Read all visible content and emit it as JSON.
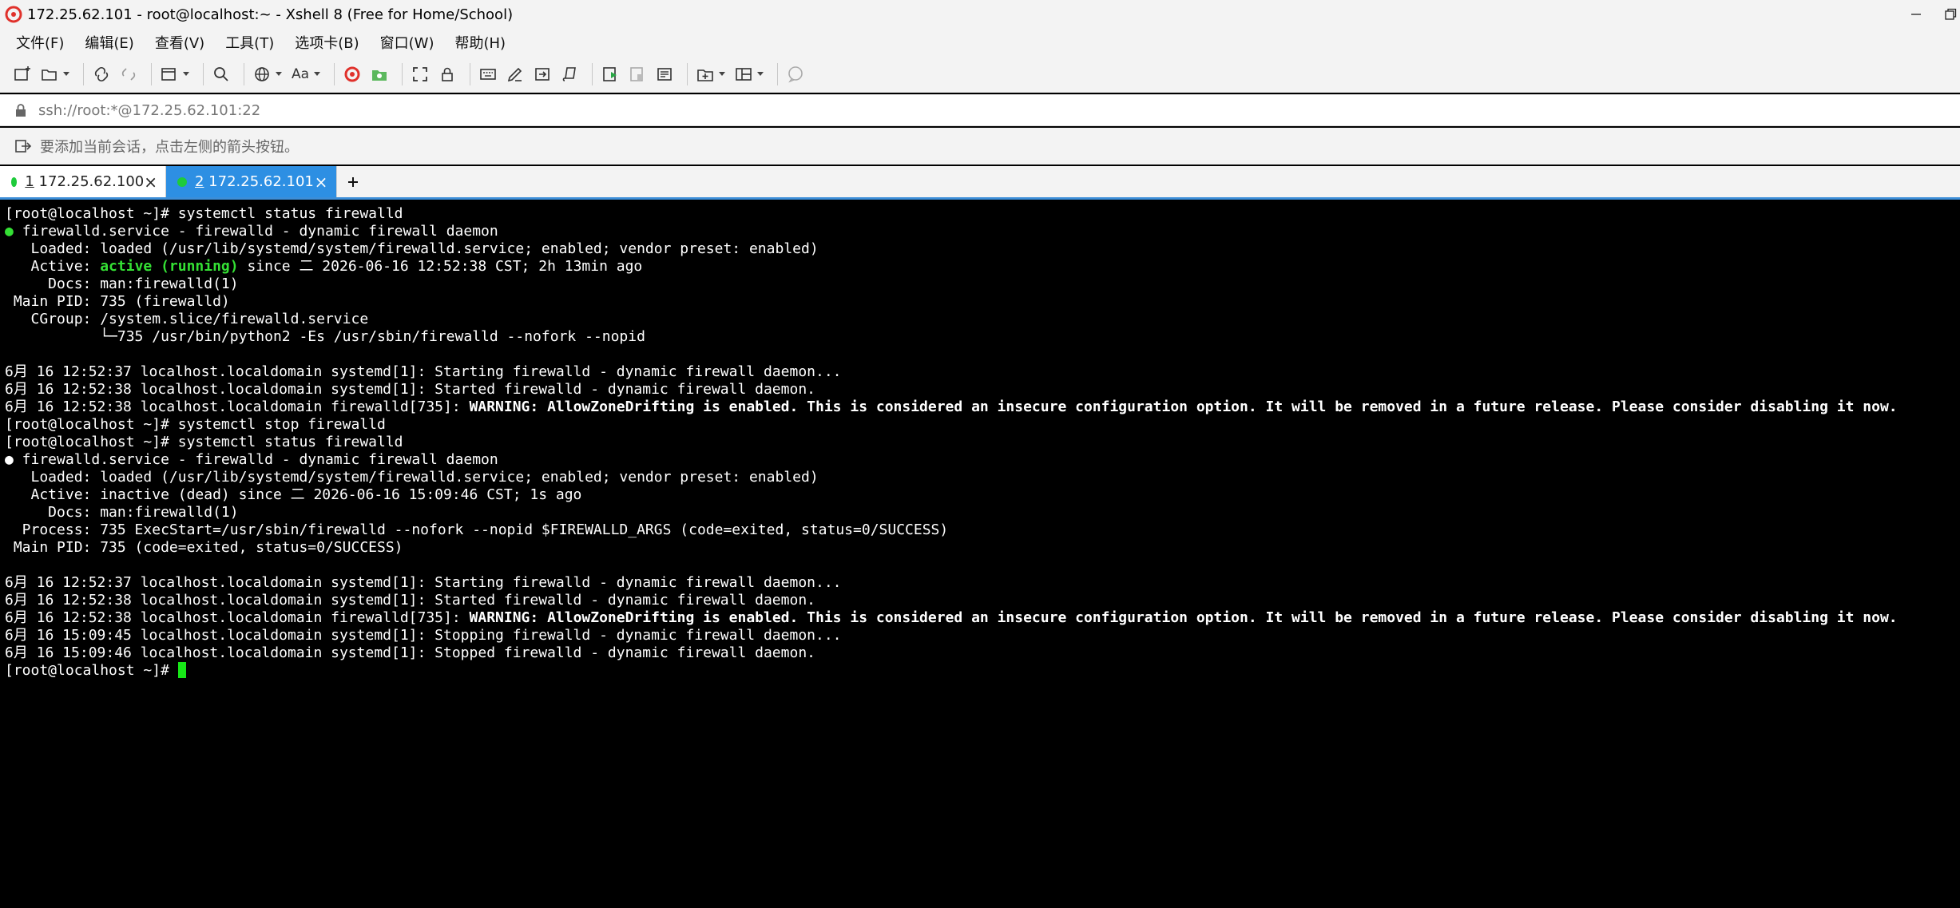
{
  "window": {
    "title": "172.25.62.101 - root@localhost:~ - Xshell 8 (Free for Home/School)",
    "app_icon": "xshell-logo"
  },
  "menu": [
    "文件(F)",
    "编辑(E)",
    "查看(V)",
    "工具(T)",
    "选项卡(B)",
    "窗口(W)",
    "帮助(H)"
  ],
  "toolbar": {
    "font_label": "Aa",
    "icons": [
      "new-session-icon",
      "open-folder-icon",
      "connect-icon",
      "disconnect-icon",
      "new-window-icon",
      "search-icon",
      "globe-icon",
      "font-icon",
      "xshell-red-icon",
      "xftp-green-icon",
      "fullscreen-icon",
      "lock-icon",
      "keyboard-icon",
      "compose-icon",
      "send-icon",
      "script-icon",
      "log-start-icon",
      "log-stop-icon",
      "notes-icon",
      "add-tab-icon",
      "layout-icon",
      "chat-icon"
    ]
  },
  "address": {
    "value": "ssh://root:*@172.25.62.101:22"
  },
  "hint": {
    "text": "要添加当前会话，点击左侧的箭头按钮。"
  },
  "tabs": [
    {
      "number": "1",
      "label": " 172.25.62.100",
      "status_color": "#1ecb3b",
      "active": false
    },
    {
      "number": "2",
      "label": " 172.25.62.101",
      "status_color": "#1ecb3b",
      "active": true
    }
  ],
  "terminal": {
    "prompt": "[root@localhost ~]# ",
    "lines": [
      {
        "segments": [
          {
            "text": "[root@localhost ~]# systemctl status firewalld"
          }
        ]
      },
      {
        "segments": [
          {
            "text": "● ",
            "style": "green"
          },
          {
            "text": "firewalld.service - firewalld - dynamic firewall daemon"
          }
        ]
      },
      {
        "segments": [
          {
            "text": "   Loaded: loaded (/usr/lib/systemd/system/firewalld.service; enabled; vendor preset: enabled)"
          }
        ]
      },
      {
        "segments": [
          {
            "text": "   Active: "
          },
          {
            "text": "active (running)",
            "style": "green"
          },
          {
            "text": " since 二 2026-06-16 12:52:38 CST; 2h 13min ago"
          }
        ]
      },
      {
        "segments": [
          {
            "text": "     Docs: man:firewalld(1)"
          }
        ]
      },
      {
        "segments": [
          {
            "text": " Main PID: 735 (firewalld)"
          }
        ]
      },
      {
        "segments": [
          {
            "text": "   CGroup: /system.slice/firewalld.service"
          }
        ]
      },
      {
        "segments": [
          {
            "text": "           └─735 /usr/bin/python2 -Es /usr/sbin/firewalld --nofork --nopid"
          }
        ]
      },
      {
        "segments": [
          {
            "text": ""
          }
        ]
      },
      {
        "segments": [
          {
            "text": "6月 16 12:52:37 localhost.localdomain systemd[1]: Starting firewalld - dynamic firewall daemon..."
          }
        ]
      },
      {
        "segments": [
          {
            "text": "6月 16 12:52:38 localhost.localdomain systemd[1]: Started firewalld - dynamic firewall daemon."
          }
        ]
      },
      {
        "segments": [
          {
            "text": "6月 16 12:52:38 localhost.localdomain firewalld[735]: "
          },
          {
            "text": "WARNING: AllowZoneDrifting is enabled. This is considered an insecure configuration option. It will be removed in a future release. Please consider disabling it now.",
            "style": "white-bold"
          }
        ]
      },
      {
        "segments": [
          {
            "text": "[root@localhost ~]# systemctl stop firewalld"
          }
        ]
      },
      {
        "segments": [
          {
            "text": "[root@localhost ~]# systemctl status firewalld"
          }
        ]
      },
      {
        "segments": [
          {
            "text": "● firewalld.service - firewalld - dynamic firewall daemon"
          }
        ]
      },
      {
        "segments": [
          {
            "text": "   Loaded: loaded (/usr/lib/systemd/system/firewalld.service; enabled; vendor preset: enabled)"
          }
        ]
      },
      {
        "segments": [
          {
            "text": "   Active: inactive (dead) since 二 2026-06-16 15:09:46 CST; 1s ago"
          }
        ]
      },
      {
        "segments": [
          {
            "text": "     Docs: man:firewalld(1)"
          }
        ]
      },
      {
        "segments": [
          {
            "text": "  Process: 735 ExecStart=/usr/sbin/firewalld --nofork --nopid $FIREWALLD_ARGS (code=exited, status=0/SUCCESS)"
          }
        ]
      },
      {
        "segments": [
          {
            "text": " Main PID: 735 (code=exited, status=0/SUCCESS)"
          }
        ]
      },
      {
        "segments": [
          {
            "text": ""
          }
        ]
      },
      {
        "segments": [
          {
            "text": "6月 16 12:52:37 localhost.localdomain systemd[1]: Starting firewalld - dynamic firewall daemon..."
          }
        ]
      },
      {
        "segments": [
          {
            "text": "6月 16 12:52:38 localhost.localdomain systemd[1]: Started firewalld - dynamic firewall daemon."
          }
        ]
      },
      {
        "segments": [
          {
            "text": "6月 16 12:52:38 localhost.localdomain firewalld[735]: "
          },
          {
            "text": "WARNING: AllowZoneDrifting is enabled. This is considered an insecure configuration option. It will be removed in a future release. Please consider disabling it now.",
            "style": "white-bold"
          }
        ]
      },
      {
        "segments": [
          {
            "text": "6月 16 15:09:45 localhost.localdomain systemd[1]: Stopping firewalld - dynamic firewall daemon..."
          }
        ]
      },
      {
        "segments": [
          {
            "text": "6月 16 15:09:46 localhost.localdomain systemd[1]: Stopped firewalld - dynamic firewall daemon."
          }
        ]
      }
    ]
  },
  "colors": {
    "accent": "#2d8fe3",
    "terminal_green": "#34e034",
    "cursor": "#17e617"
  }
}
